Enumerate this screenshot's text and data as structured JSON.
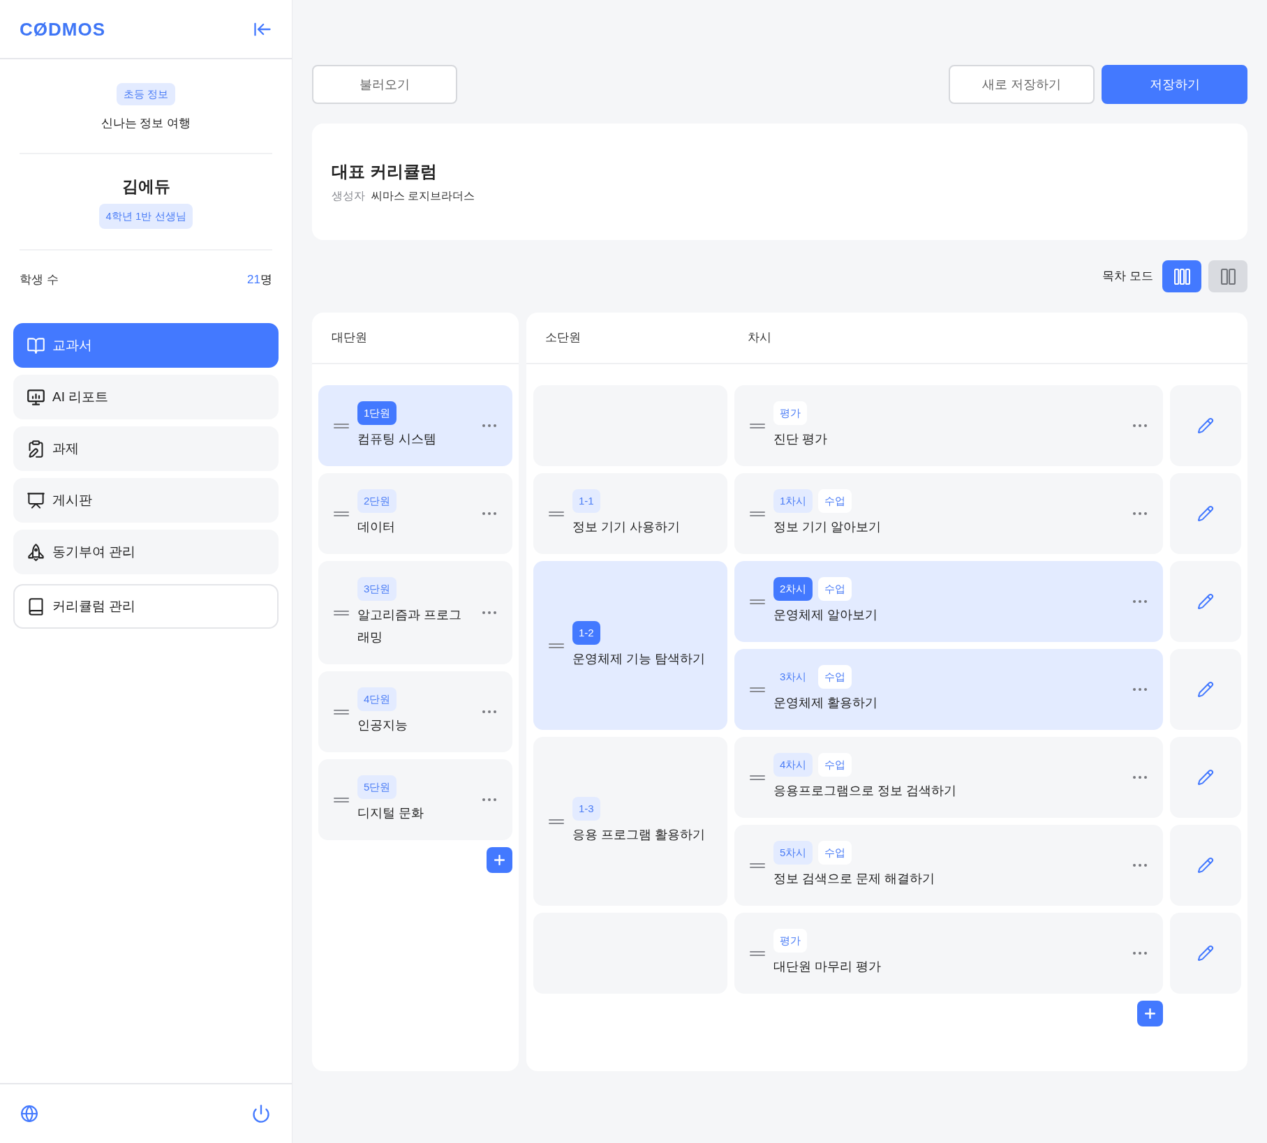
{
  "sidebar": {
    "logo": "CØDMOS",
    "subject_tag": "초등 정보",
    "textbook": "신나는 정보 여행",
    "teacher_name": "김에듀",
    "teacher_role": "4학년 1반 선생님",
    "student_count": {
      "label": "학생 수",
      "value": "21",
      "unit": "명"
    },
    "nav": [
      {
        "label": "교과서",
        "kind": "menu",
        "selected": true
      },
      {
        "label": "AI 리포트",
        "kind": "menu",
        "selected": false
      },
      {
        "label": "과제",
        "kind": "menu",
        "selected": false
      },
      {
        "label": "게시판",
        "kind": "menu",
        "selected": false
      },
      {
        "label": "동기부여 관리",
        "kind": "menu",
        "selected": false
      },
      {
        "label": "커리큘럼 관리",
        "kind": "outline",
        "selected": false
      }
    ]
  },
  "toolbar": {
    "left_buttons": [
      {
        "label": "불러오기",
        "kind": "outline"
      }
    ],
    "right_buttons": [
      {
        "label": "새로 저장하기",
        "kind": "outline"
      },
      {
        "label": "저장하기",
        "kind": "primary"
      }
    ]
  },
  "curriculum": {
    "title": "대표 커리큘럼",
    "creator_label": "생성자",
    "creator": "씨마스 로지브라더스"
  },
  "view_mode": {
    "label": "목차 모드",
    "options": [
      {
        "selected": true
      },
      {
        "selected": false
      }
    ]
  },
  "table": {
    "columns": [
      "대단원",
      "소단원",
      "차시"
    ],
    "units": [
      {
        "badge": "1단원",
        "title": "컴퓨팅 시스템",
        "selected": true
      },
      {
        "badge": "2단원",
        "title": "데이터",
        "selected": false
      },
      {
        "badge": "3단원",
        "title": "알고리즘과 프로그래밍",
        "selected": false
      },
      {
        "badge": "4단원",
        "title": "인공지능",
        "selected": false
      },
      {
        "badge": "5단원",
        "title": "디지털 문화",
        "selected": false
      }
    ],
    "groups": [
      {
        "kind": "none",
        "selected": false,
        "lessons": [
          {
            "type": "평가",
            "title": "진단 평가",
            "selected": false
          }
        ]
      },
      {
        "kind": "subunit",
        "badge": "1-1",
        "title": "정보 기기 사용하기",
        "selected": false,
        "lessons": [
          {
            "number": "1차시",
            "type": "수업",
            "title": "정보 기기 알아보기",
            "selected": false
          }
        ]
      },
      {
        "kind": "subunit",
        "badge": "1-2",
        "title": "운영체제 기능 탐색하기",
        "selected": true,
        "lessons": [
          {
            "number": "2차시",
            "type": "수업",
            "title": "운영체제 알아보기",
            "selected": true
          },
          {
            "number": "3차시",
            "type": "수업",
            "title": "운영체제 활용하기",
            "selected": false
          }
        ]
      },
      {
        "kind": "subunit",
        "badge": "1-3",
        "title": "응용 프로그램 활용하기",
        "selected": false,
        "lessons": [
          {
            "number": "4차시",
            "type": "수업",
            "title": "응용프로그램으로 정보 검색하기",
            "selected": false
          },
          {
            "number": "5차시",
            "type": "수업",
            "title": "정보 검색으로 문제 해결하기",
            "selected": false
          }
        ]
      },
      {
        "kind": "none",
        "selected": false,
        "lessons": [
          {
            "type": "평가",
            "title": "대단원 마무리 평가",
            "selected": false
          }
        ]
      }
    ]
  }
}
